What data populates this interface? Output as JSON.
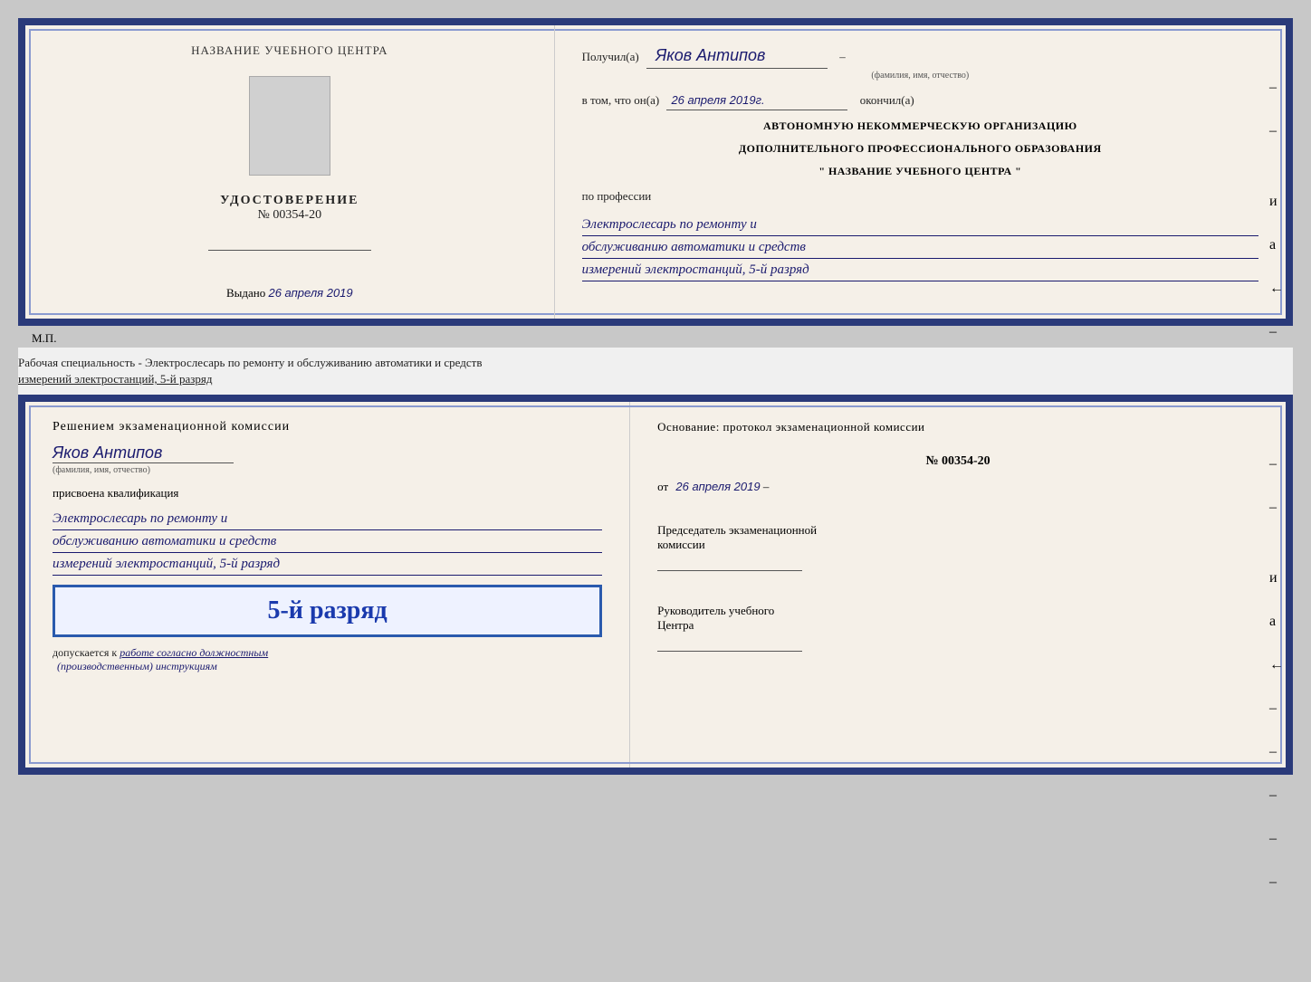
{
  "top_diploma": {
    "left": {
      "center_title": "НАЗВАНИЕ УЧЕБНОГО ЦЕНТРА",
      "cert_label": "УДОСТОВЕРЕНИЕ",
      "cert_number": "№ 00354-20",
      "issued_label": "Выдано",
      "issued_date": "26 апреля 2019",
      "mp_label": "М.П."
    },
    "right": {
      "received_label": "Получил(а)",
      "recipient_name": "Яков Антипов",
      "fio_label": "(фамилия, имя, отчество)",
      "in_that_label": "в том, что он(а)",
      "completion_date": "26 апреля 2019г.",
      "finished_label": "окончил(а)",
      "org_line1": "АВТОНОМНУЮ НЕКОММЕРЧЕСКУЮ ОРГАНИЗАЦИЮ",
      "org_line2": "ДОПОЛНИТЕЛЬНОГО ПРОФЕССИОНАЛЬНОГО ОБРАЗОВАНИЯ",
      "org_quote": "\"  НАЗВАНИЕ УЧЕБНОГО ЦЕНТРА  \"",
      "profession_label": "по профессии",
      "profession_line1": "Электрослесарь по ремонту и",
      "profession_line2": "обслуживанию автоматики и средств",
      "profession_line3": "измерений электростанций, 5-й разряд"
    }
  },
  "separator": {
    "text_line1": "Рабочая специальность - Электрослесарь по ремонту и обслуживанию автоматики и средств",
    "text_line2": "измерений электростанций, 5-й разряд"
  },
  "bottom_diploma": {
    "left": {
      "decision_label": "Решением экзаменационной комиссии",
      "recipient_name": "Яков Антипов",
      "fio_label": "(фамилия, имя, отчество)",
      "qualification_label": "присвоена квалификация",
      "profession_line1": "Электрослесарь по ремонту и",
      "profession_line2": "обслуживанию автоматики и средств",
      "profession_line3": "измерений электростанций, 5-й разряд",
      "rank_big": "5-й разряд",
      "admitted_label": "допускается к",
      "admitted_handwritten": "работе согласно должностным",
      "admitted_handwritten2": "(производственным) инструкциям"
    },
    "right": {
      "basis_label": "Основание: протокол экзаменационной комиссии",
      "protocol_number": "№ 00354-20",
      "date_label": "от",
      "date_value": "26 апреля 2019",
      "chairman_label": "Председатель экзаменационной",
      "chairman_label2": "комиссии",
      "director_label": "Руководитель учебного",
      "director_label2": "Центра"
    }
  },
  "side_marks": {
    "marks": [
      "–",
      "–",
      "и",
      "а",
      "←",
      "–",
      "–",
      "–",
      "–",
      "–"
    ]
  }
}
